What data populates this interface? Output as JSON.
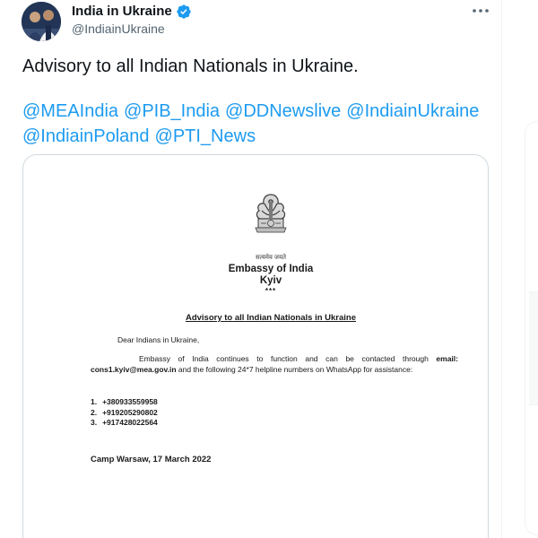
{
  "author": {
    "display_name": "India in Ukraine",
    "handle": "@IndiainUkraine",
    "avatar": "avatar-photo",
    "verified": true
  },
  "tweet": {
    "text": "Advisory to all Indian Nationals in Ukraine.",
    "mentions": [
      "@MEAIndia",
      "@PIB_India",
      "@DDNewslive",
      "@IndiainUkraine",
      "@IndiainPoland",
      "@PTI_News"
    ]
  },
  "document": {
    "emblem_caption": "सत्यमेव जयते",
    "embassy_name": "Embassy of India",
    "embassy_city": "Kyiv",
    "separator": "***",
    "title": "Advisory to all Indian Nationals in Ukraine",
    "salutation": "Dear Indians in Ukraine,",
    "body_intro": "Embassy of India continues to function and can be contacted through ",
    "email_label": "email:",
    "email": "cons1.kyiv@mea.gov.in",
    "body_outro": " and the following 24*7 helpline numbers on WhatsApp for assistance:",
    "phones": [
      {
        "num": "1.",
        "value": "+380933559958"
      },
      {
        "num": "2.",
        "value": "+919205290802"
      },
      {
        "num": "3.",
        "value": "+917428022564"
      }
    ],
    "signoff": "Camp Warsaw, 17 March 2022"
  },
  "icons": {
    "verified": "verified-badge-icon",
    "more": "more-options-icon",
    "emblem": "national-emblem-icon"
  },
  "colors": {
    "link": "#1d9bf0",
    "text": "#0f1419",
    "secondary": "#536471",
    "border": "#cfd9de"
  }
}
